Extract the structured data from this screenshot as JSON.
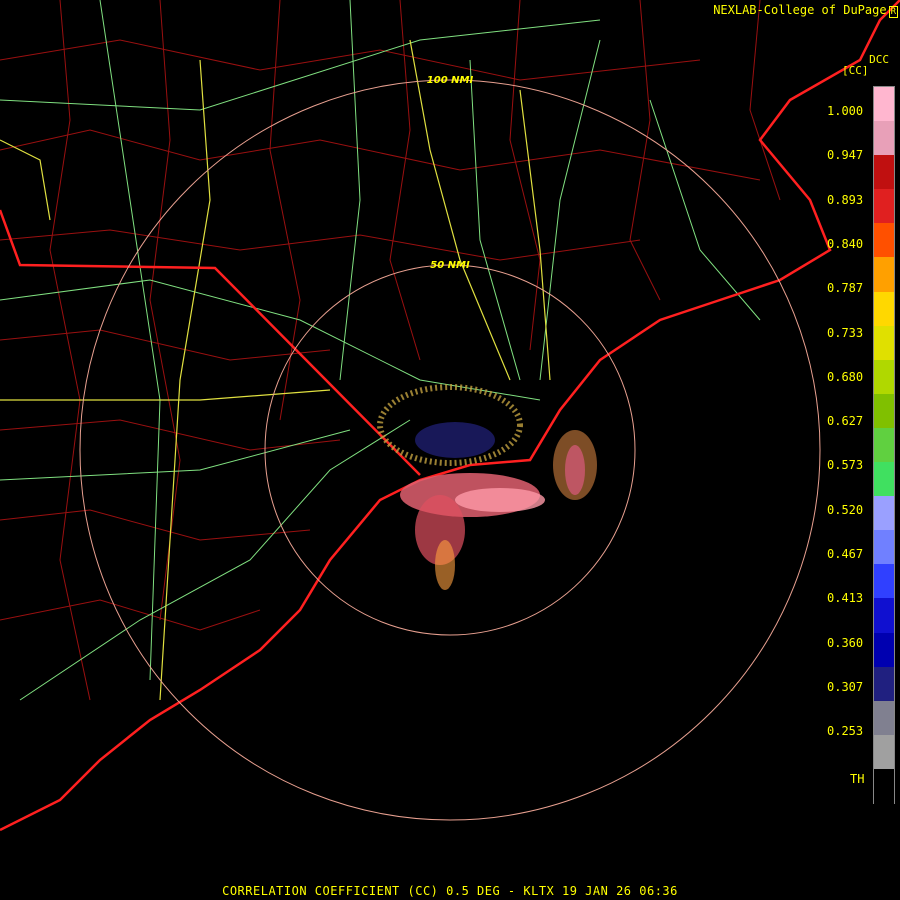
{
  "credit": "NEXLAB-College of DuPage",
  "credit_mark": "R",
  "dcc": "DCC",
  "product_tag": "[CC]",
  "range_rings": [
    "100 NMI",
    "50 NMI"
  ],
  "legend": {
    "labels": [
      "1.000",
      "0.947",
      "0.893",
      "0.840",
      "0.787",
      "0.733",
      "0.680",
      "0.627",
      "0.573",
      "0.520",
      "0.467",
      "0.413",
      "0.360",
      "0.307",
      "0.253",
      "TH"
    ],
    "colors": [
      "#ffb6cf",
      "#e8a0b8",
      "#c01010",
      "#e02020",
      "#ff5000",
      "#ffa000",
      "#ffd800",
      "#e0e000",
      "#b0d800",
      "#80c000",
      "#60d040",
      "#40e060",
      "#9aa0ff",
      "#7080ff",
      "#3040ff",
      "#1010d0",
      "#0000b0",
      "#202080",
      "#808090",
      "#a0a0a0",
      "#000000"
    ]
  },
  "title": "CORRELATION COEFFICIENT (CC) 0.5 DEG - KLTX 19 JAN 26 06:36",
  "colors": {
    "coast": "#ff2020",
    "state": "#ff2020",
    "county": "#a01010",
    "road_major": "#e0e040",
    "road_minor": "#80e080",
    "ring": "#e8a090"
  }
}
